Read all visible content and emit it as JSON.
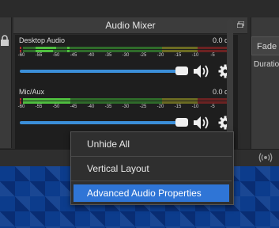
{
  "mixer": {
    "title": "Audio Mixer",
    "channels": [
      {
        "name": "Desktop Audio",
        "db": "0.0 dB",
        "volume_fraction": 0.94,
        "muted": false,
        "ticks": [
          "-60",
          "-55",
          "-50",
          "-45",
          "-40",
          "-35",
          "-30",
          "-25",
          "-20",
          "-15",
          "-10",
          "-5",
          "0"
        ]
      },
      {
        "name": "Mic/Aux",
        "db": "0.0 dB",
        "volume_fraction": 0.94,
        "muted": false,
        "ticks": [
          "-60",
          "-55",
          "-50",
          "-45",
          "-40",
          "-35",
          "-30",
          "-25",
          "-20",
          "-15",
          "-10",
          "-5",
          "0"
        ]
      }
    ]
  },
  "right_panel": {
    "fade_label": "Fade",
    "duration_label": "Duration"
  },
  "context_menu": {
    "items": [
      {
        "label": "Unhide All",
        "selected": false
      },
      {
        "label": "Vertical Layout",
        "selected": false
      },
      {
        "label": "Advanced Audio Properties",
        "selected": true
      }
    ]
  },
  "colors": {
    "meter_green": "#4fbf3f",
    "meter_yellow": "#b8b83a",
    "meter_red": "#b03030",
    "slider_blue": "#3b8fd9",
    "menu_highlight": "#2f75d6",
    "wallpaper_blue": "#0c3c8c"
  },
  "icons": [
    "lock-icon",
    "float-icon",
    "speaker-icon",
    "gear-icon",
    "broadcast-icon"
  ]
}
